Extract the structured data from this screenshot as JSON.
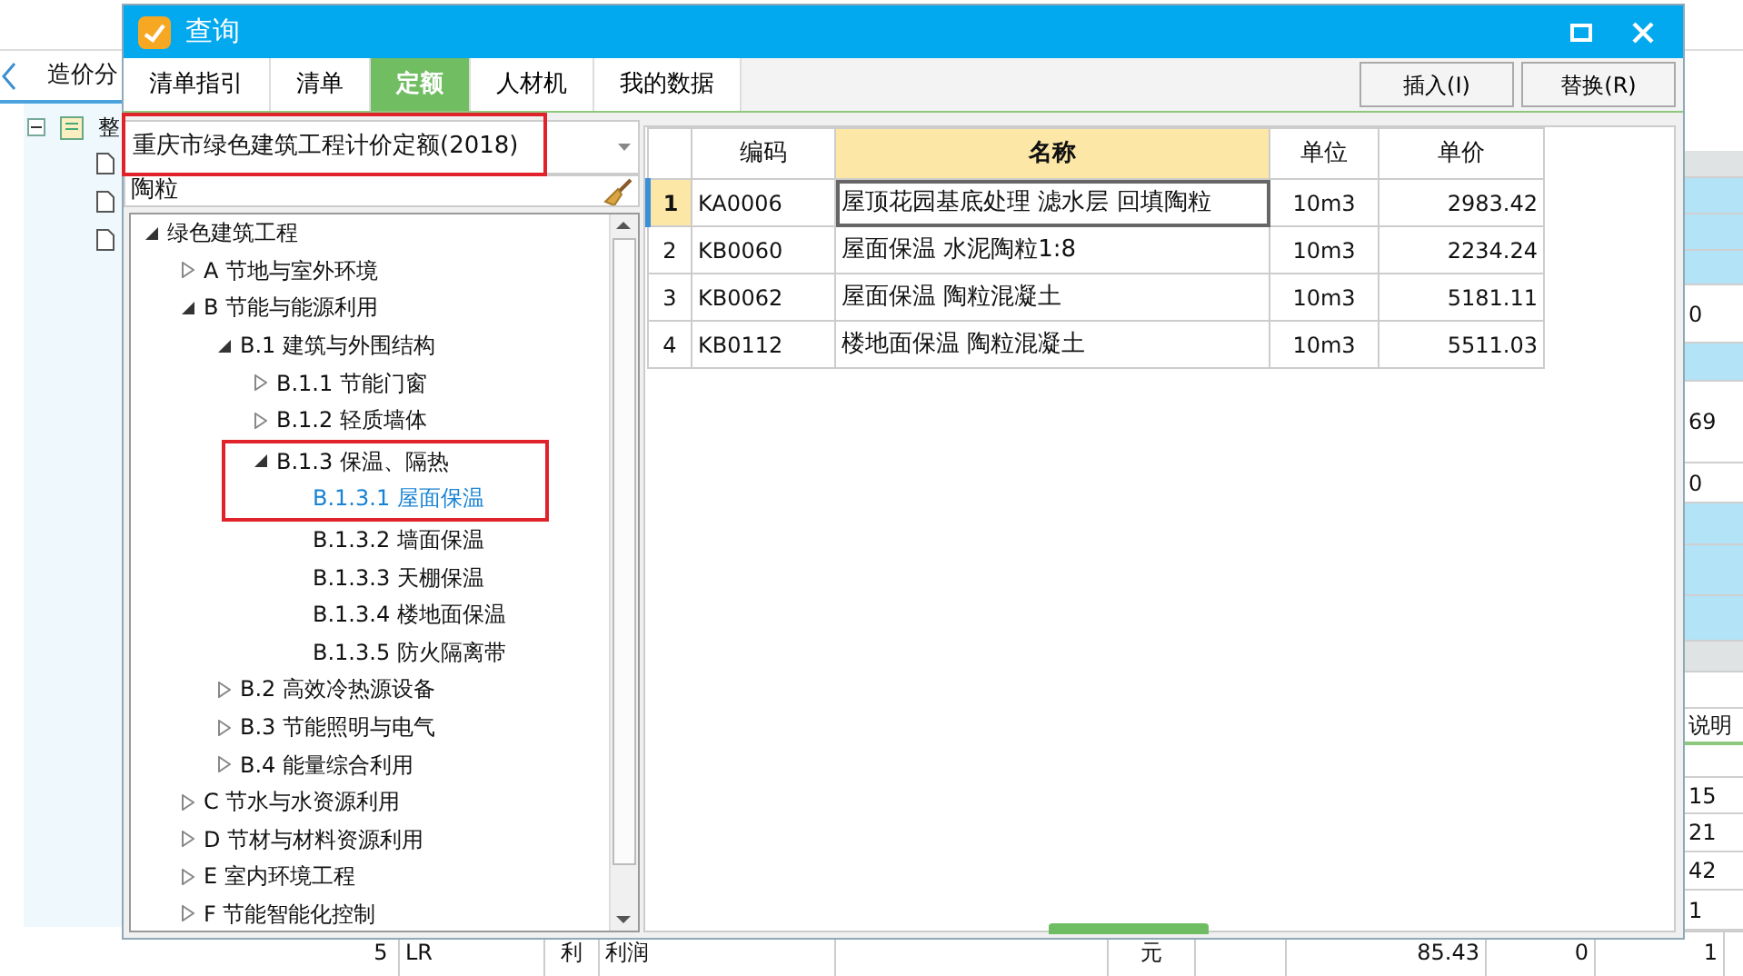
{
  "background": {
    "tab": "造价分",
    "tree_root": "整",
    "right_cells": [
      {
        "kind": "header"
      },
      {
        "kind": "blue"
      },
      {
        "kind": "blue"
      },
      {
        "kind": "blue"
      },
      {
        "kind": "value",
        "text": "0"
      },
      {
        "kind": "blue"
      },
      {
        "kind": "value",
        "text": "69"
      },
      {
        "kind": "value",
        "text": "0"
      },
      {
        "kind": "blue"
      },
      {
        "kind": "blue"
      },
      {
        "kind": "blue"
      },
      {
        "kind": "header"
      },
      {
        "kind": "blank"
      },
      {
        "kind": "tab",
        "text": "说明"
      },
      {
        "kind": "blank"
      },
      {
        "kind": "value",
        "text": "15"
      },
      {
        "kind": "value",
        "text": "21"
      },
      {
        "kind": "value",
        "text": "42"
      },
      {
        "kind": "value",
        "text": "1"
      }
    ],
    "bottom_row": [
      "5",
      "LR",
      "利",
      "利润",
      "元",
      "85.43",
      "0",
      "1"
    ]
  },
  "dialog": {
    "title": "查询",
    "tabs": [
      {
        "label": "清单指引",
        "selected": false
      },
      {
        "label": "清单",
        "selected": false
      },
      {
        "label": "定额",
        "selected": true
      },
      {
        "label": "人材机",
        "selected": false
      },
      {
        "label": "我的数据",
        "selected": false
      }
    ],
    "buttons": [
      "插入(I)",
      "替换(R)"
    ],
    "combo": {
      "value": "重庆市绿色建筑工程计价定额(2018)",
      "highlighted": true
    },
    "search": {
      "value": "陶粒"
    },
    "tree": [
      {
        "label": "绿色建筑工程",
        "expanded": true,
        "children": [
          {
            "label": "A 节地与室外环境",
            "expanded": false
          },
          {
            "label": "B 节能与能源利用",
            "expanded": true,
            "children": [
              {
                "label": "B.1 建筑与外围结构",
                "expanded": true,
                "children": [
                  {
                    "label": "B.1.1 节能门窗",
                    "expanded": false
                  },
                  {
                    "label": "B.1.2 轻质墙体",
                    "expanded": false
                  },
                  {
                    "label": "B.1.3 保温、隔热",
                    "expanded": true,
                    "highlighted": true,
                    "children": [
                      {
                        "label": "B.1.3.1 屋面保温",
                        "selected": true,
                        "highlighted": true
                      },
                      {
                        "label": "B.1.3.2 墙面保温",
                        "selected": false
                      },
                      {
                        "label": "B.1.3.3 天棚保温",
                        "selected": false
                      },
                      {
                        "label": "B.1.3.4 楼地面保温",
                        "selected": false
                      },
                      {
                        "label": "B.1.3.5 防火隔离带",
                        "selected": false
                      }
                    ]
                  }
                ]
              },
              {
                "label": "B.2 高效冷热源设备",
                "expanded": false
              },
              {
                "label": "B.3 节能照明与电气",
                "expanded": false
              },
              {
                "label": "B.4 能量综合利用",
                "expanded": false
              }
            ]
          },
          {
            "label": "C 节水与水资源利用",
            "expanded": false
          },
          {
            "label": "D 节材与材料资源利用",
            "expanded": false
          },
          {
            "label": "E 室内环境工程",
            "expanded": false
          },
          {
            "label": "F 节能智能化控制",
            "expanded": false
          }
        ]
      }
    ],
    "grid": {
      "columns": [
        {
          "label": "编码",
          "active": false
        },
        {
          "label": "名称",
          "active": true
        },
        {
          "label": "单位",
          "active": false
        },
        {
          "label": "单价",
          "active": false
        }
      ],
      "rows": [
        {
          "index": "1",
          "code": "KA0006",
          "name": "屋顶花园基底处理 滤水层 回填陶粒",
          "unit": "10m3",
          "price": "2983.42",
          "selected": true
        },
        {
          "index": "2",
          "code": "KB0060",
          "name": "屋面保温 水泥陶粒1:8",
          "unit": "10m3",
          "price": "2234.24",
          "selected": false
        },
        {
          "index": "3",
          "code": "KB0062",
          "name": "屋面保温 陶粒混凝土",
          "unit": "10m3",
          "price": "5181.11",
          "selected": false
        },
        {
          "index": "4",
          "code": "KB0112",
          "name": "楼地面保温 陶粒混凝土",
          "unit": "10m3",
          "price": "5511.03",
          "selected": false
        }
      ]
    }
  }
}
